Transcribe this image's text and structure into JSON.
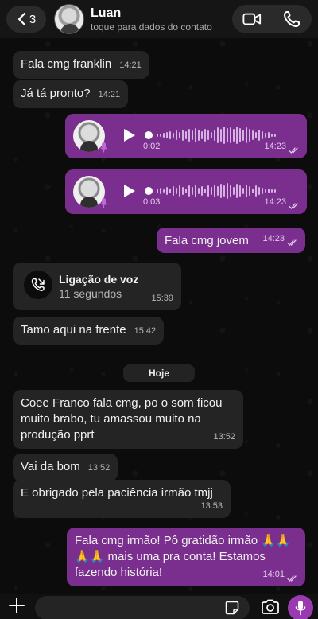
{
  "header": {
    "back_count": "3",
    "contact_name": "Luan",
    "contact_subtitle": "toque para dados do contato"
  },
  "messages": [
    {
      "text": "Fala cmg franklin",
      "time": "14:21"
    },
    {
      "text": "Já tá pronto?",
      "time": "14:21"
    },
    {
      "duration": "0:02",
      "time": "14:23"
    },
    {
      "duration": "0:03",
      "time": "14:23"
    },
    {
      "text": "Fala cmg jovem",
      "time": "14:23"
    },
    {
      "title": "Ligação de voz",
      "subtitle": "11 segundos",
      "time": "15:39"
    },
    {
      "text": "Tamo aqui na frente",
      "time": "15:42"
    },
    {
      "text": "Coee Franco fala cmg, po o som ficou muito brabo, tu amassou muito na produção pprt",
      "time": "13:52"
    },
    {
      "text": "Vai da bom",
      "time": "13:52"
    },
    {
      "text": "E obrigado pela paciência irmão tmjj",
      "time": "13:53"
    },
    {
      "text": "Fala cmg irmão! Pô gratidão irmão 🙏🙏🙏🙏 mais uma pra conta! Estamos fazendo história!",
      "time": "14:01"
    }
  ],
  "day_separator": "Hoje",
  "colors": {
    "outgoing_bubble": "#7a2e8e",
    "incoming_bubble": "#242424",
    "accent": "#9a3ab0"
  }
}
